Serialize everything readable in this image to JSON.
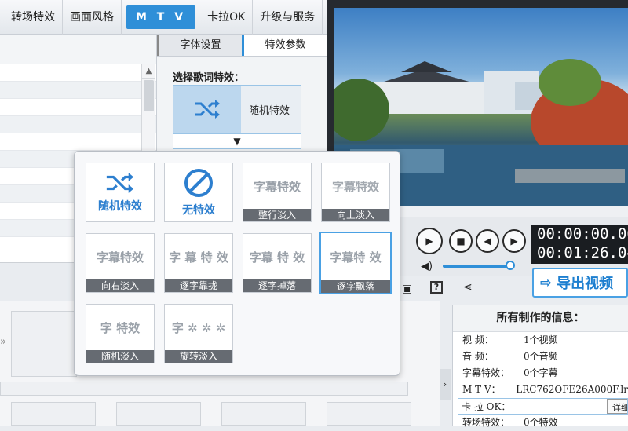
{
  "top_tabs": [
    "转场特效",
    "画面风格",
    "M T V",
    "卡拉OK",
    "升级与服务"
  ],
  "active_tab": "M T V",
  "sub_tabs": [
    "字体设置",
    "特效参数"
  ],
  "effect_select": {
    "label": "选择歌词特效：",
    "current": "随机特效",
    "dropdown_icon": "▼"
  },
  "effects": [
    {
      "caption": "随机特效",
      "art": "随机特效",
      "icon": "shuffle-icon",
      "style": "icon"
    },
    {
      "caption": "无特效",
      "art": "无特效",
      "icon": "no-effect-icon",
      "style": "icon"
    },
    {
      "caption": "整行淡入",
      "art": "字幕特效",
      "style": "ghost"
    },
    {
      "caption": "向上淡入",
      "art": "字幕特效",
      "style": "ghost"
    },
    {
      "caption": "向右淡入",
      "art": "字幕特效",
      "style": "fade-right"
    },
    {
      "caption": "逐字靠拢",
      "art": "字 幕 特 效",
      "style": "gather"
    },
    {
      "caption": "逐字掉落",
      "art": "字幕 特 效",
      "style": "drop"
    },
    {
      "caption": "逐字飘落",
      "art": "字幕特 效",
      "style": "float",
      "selected": true
    },
    {
      "caption": "随机淡入",
      "art": "字    特效",
      "style": "random"
    },
    {
      "caption": "旋转淡入",
      "art": "字 ✲ ✲ ✲",
      "style": "rotate"
    }
  ],
  "player": {
    "time_current": "00:00:00.00",
    "time_total": "00:01:26.04",
    "export_label": "导出视频",
    "volume": 0.9
  },
  "info": {
    "title": "所有制作的信息：",
    "rows": [
      {
        "key": "视    频：",
        "value": "1个视频"
      },
      {
        "key": "音    频：",
        "value": "0个音频"
      },
      {
        "key": "字幕特效：",
        "value": "0个字幕"
      },
      {
        "key": "M   T   V：",
        "value": "LRC762OFE26A000F.lr"
      },
      {
        "key": "卡 拉 OK：",
        "value": "",
        "button": "详细"
      },
      {
        "key": "转场特效：",
        "value": "0个特效"
      }
    ]
  },
  "colors": {
    "accent": "#2f8fd8",
    "caption_bg": "#666b72"
  }
}
